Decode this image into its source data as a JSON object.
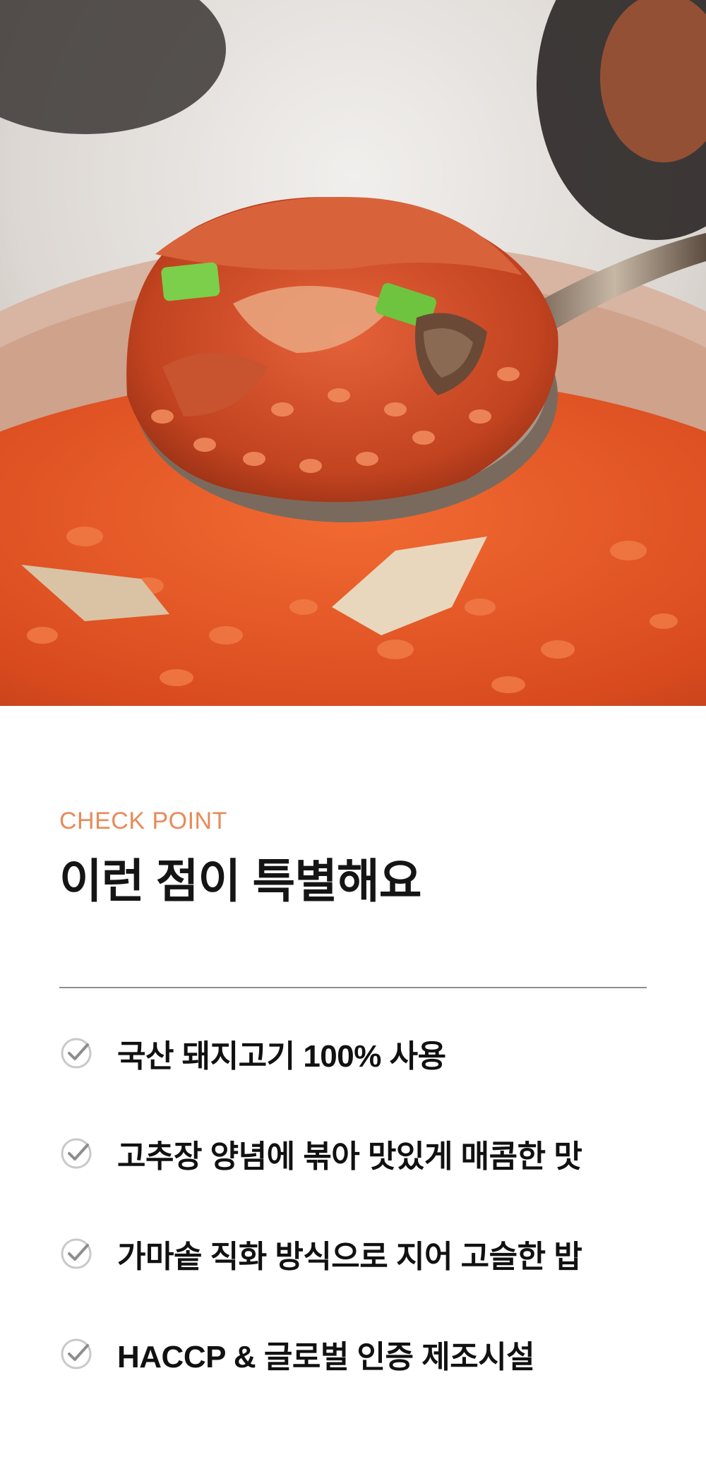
{
  "hero": {
    "image_description": "kimchi-pork-fried-rice-on-spoon"
  },
  "section": {
    "eyebrow": "CHECK POINT",
    "title": "이런 점이 특별해요"
  },
  "points": [
    {
      "icon": "check-circle-icon",
      "text": "국산 돼지고기 100% 사용"
    },
    {
      "icon": "check-circle-icon",
      "text": "고추장 양념에 볶아 맛있게 매콤한 맛"
    },
    {
      "icon": "check-circle-icon",
      "text": "가마솥 직화 방식으로 지어 고슬한 밥"
    },
    {
      "icon": "check-circle-icon",
      "text": "HACCP & 글로벌 인증 제조시설"
    }
  ],
  "colors": {
    "accent": "#e88a5a",
    "text": "#111111",
    "divider": "#8f8f8f",
    "icon": "#9a9a9a"
  }
}
